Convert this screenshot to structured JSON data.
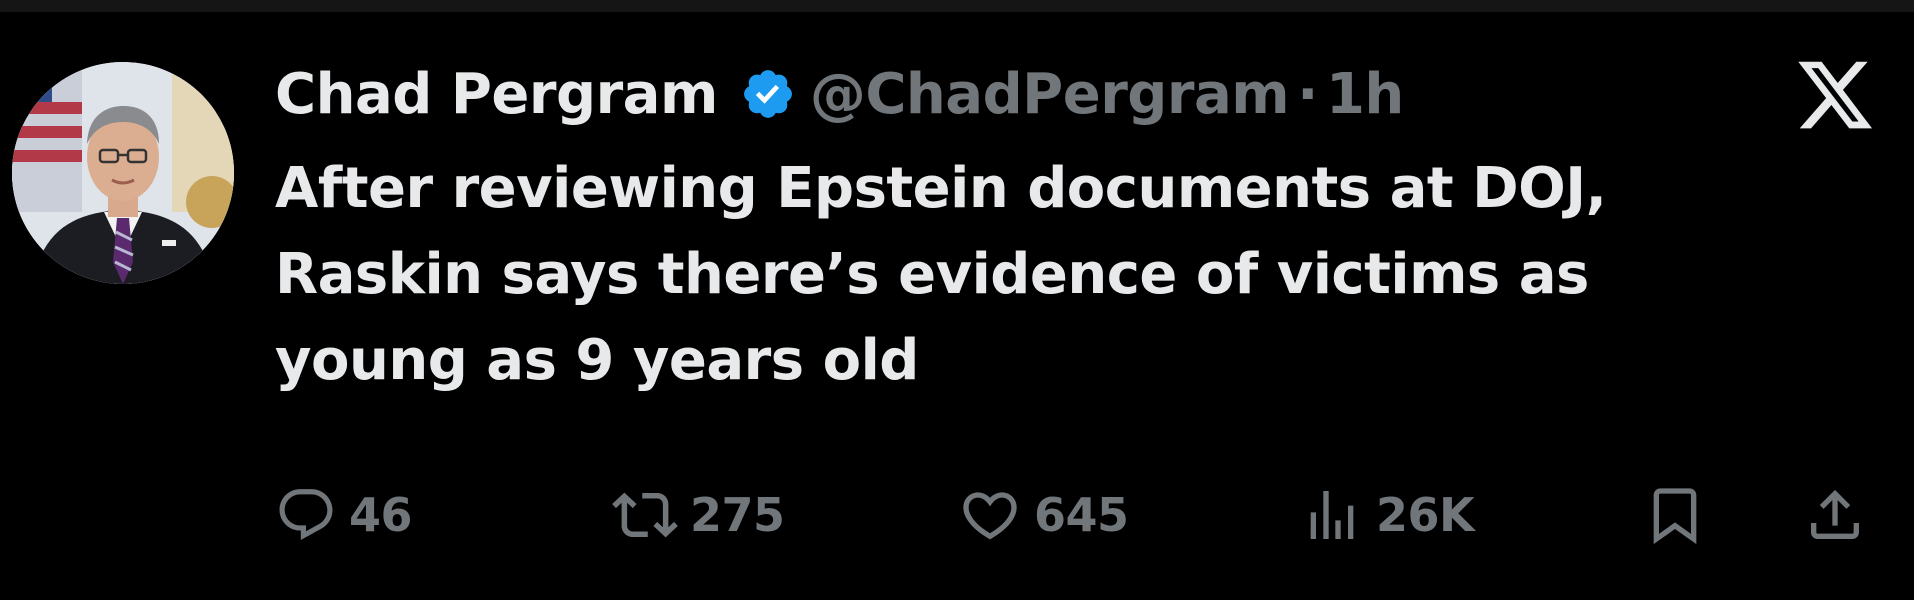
{
  "tweet": {
    "author": {
      "display_name": "Chad Pergram",
      "handle": "@ChadPergram",
      "verified": true,
      "avatar_icon": "profile-photo"
    },
    "separator": "·",
    "timestamp": "1h",
    "platform_icon": "x-logo-icon",
    "text_lines": [
      "After reviewing Epstein documents at DOJ,",
      "Raskin says there’s evidence of victims as",
      "young as 9 years old"
    ],
    "actions": {
      "replies": "46",
      "reposts": "275",
      "likes": "645",
      "views": "26K"
    }
  },
  "colors": {
    "background": "#000000",
    "primary_text": "#e7e9ea",
    "secondary_text": "#71767b",
    "verified_badge": "#1d9bf0"
  }
}
